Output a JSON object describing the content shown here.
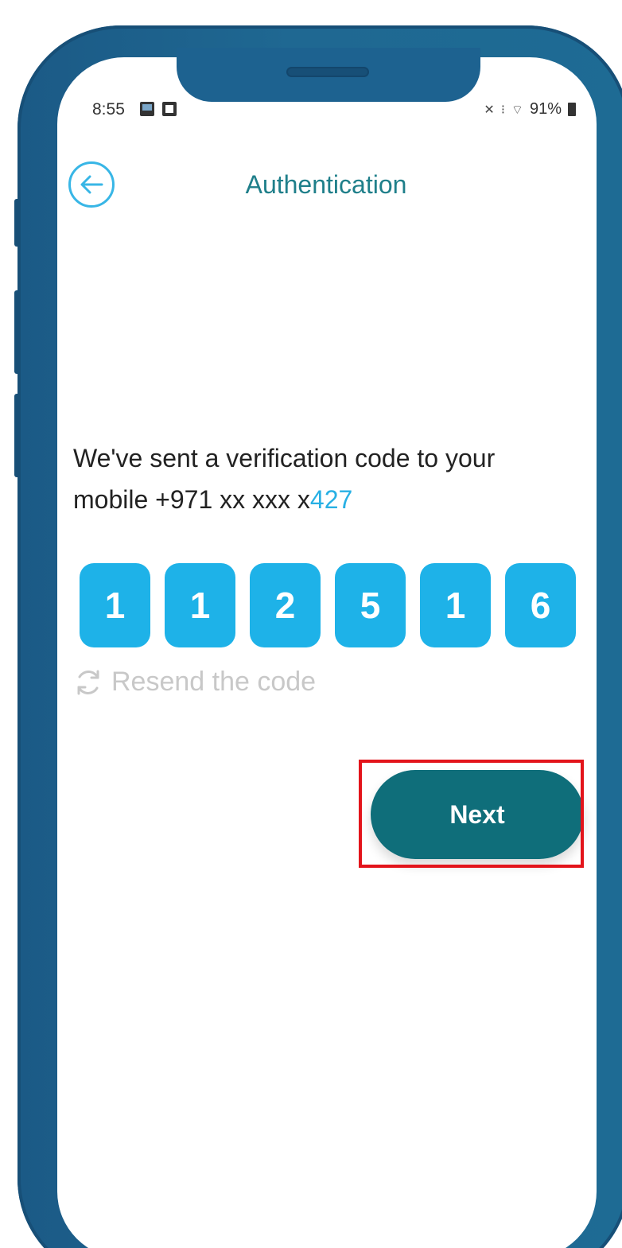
{
  "status_bar": {
    "time": "8:55",
    "battery": "91%"
  },
  "header": {
    "title": "Authentication"
  },
  "message": {
    "line1": "We've sent a verification code to your",
    "line2_prefix": "mobile +971 xx xxx x",
    "line2_suffix": "427"
  },
  "code": {
    "digits": [
      "1",
      "1",
      "2",
      "5",
      "1",
      "6"
    ]
  },
  "resend": {
    "label": "Resend the code"
  },
  "next_button": {
    "label": "Next"
  },
  "colors": {
    "frame": "#1e6690",
    "accent_blue": "#1eb2e8",
    "title_teal": "#1f7f8a",
    "button_teal": "#0f6e7a",
    "highlight_red": "#e3141b"
  }
}
